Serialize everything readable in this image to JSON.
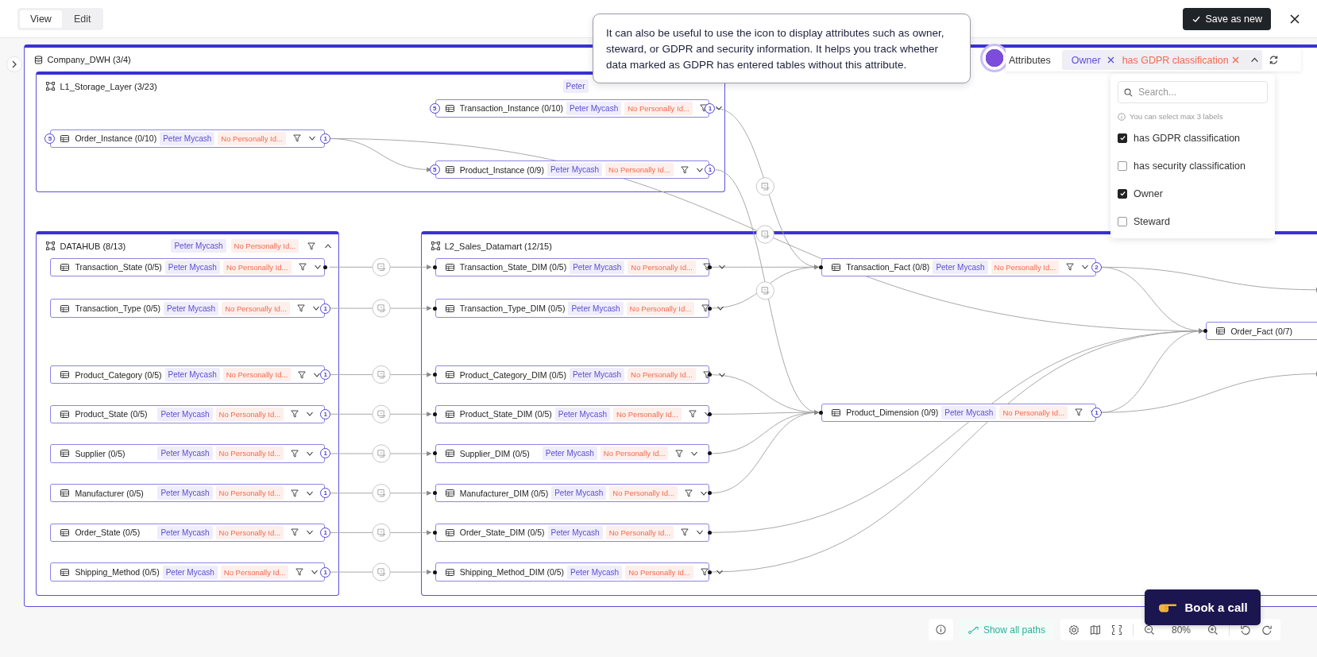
{
  "toolbar": {
    "modes": [
      {
        "label": "View",
        "selected": true
      },
      {
        "label": "Edit",
        "selected": false
      }
    ],
    "save_button": "Save as new"
  },
  "diagram": {
    "title": "Company_DWH (3/4)",
    "groups": [
      {
        "title": "L1_Storage_Layer (3/23)",
        "owner": "Peter",
        "tables": [
          {
            "name": "Transaction_Instance (0/10)",
            "owner": "Peter Mycash",
            "classification": "No Personally Id...",
            "in": {
              "kind": "count",
              "label": "5"
            },
            "out": {
              "kind": "count",
              "label": "1"
            }
          },
          {
            "name": "Order_Instance (0/10)",
            "owner": "Peter Mycash",
            "classification": "No Personally Id...",
            "in": {
              "kind": "count",
              "label": "5"
            },
            "out": {
              "kind": "count",
              "label": "1"
            }
          },
          {
            "name": "Product_Instance (0/9)",
            "owner": "Peter Mycash",
            "classification": "No Personally Id...",
            "in": {
              "kind": "count",
              "label": "5"
            },
            "out": {
              "kind": "count",
              "label": "1"
            }
          }
        ]
      },
      {
        "title": "DATAHUB (8/13)",
        "owner": "Peter Mycash",
        "classification": "No Personally Id...",
        "expanded": true,
        "tables": [
          {
            "name": "Transaction_State (0/5)",
            "owner": "Peter Mycash",
            "classification": "No Personally Id...",
            "out": {
              "kind": "dot"
            }
          },
          {
            "name": "Transaction_Type (0/5)",
            "owner": "Peter Mycash",
            "classification": "No Personally Id...",
            "out": {
              "kind": "count",
              "label": "1"
            }
          },
          {
            "name": "Product_Category (0/5)",
            "owner": "Peter Mycash",
            "classification": "No Personally Id...",
            "out": {
              "kind": "count",
              "label": "1"
            }
          },
          {
            "name": "Product_State (0/5)",
            "owner": "Peter Mycash",
            "classification": "No Personally Id...",
            "out": {
              "kind": "count",
              "label": "1"
            }
          },
          {
            "name": "Supplier (0/5)",
            "owner": "Peter Mycash",
            "classification": "No Personally Id...",
            "out": {
              "kind": "count",
              "label": "1"
            }
          },
          {
            "name": "Manufacturer (0/5)",
            "owner": "Peter Mycash",
            "classification": "No Personally Id...",
            "out": {
              "kind": "count",
              "label": "1"
            }
          },
          {
            "name": "Order_State (0/5)",
            "owner": "Peter Mycash",
            "classification": "No Personally Id...",
            "out": {
              "kind": "count",
              "label": "1"
            }
          },
          {
            "name": "Shipping_Method (0/5)",
            "owner": "Peter Mycash",
            "classification": "No Personally Id...",
            "out": {
              "kind": "count",
              "label": "1"
            }
          }
        ]
      },
      {
        "title": "L2_Sales_Datamart (12/15)",
        "tables": [
          {
            "name": "Transaction_State_DIM (0/5)",
            "owner": "Peter Mycash",
            "classification": "No Personally Id...",
            "in": {
              "kind": "dot"
            },
            "out": {
              "kind": "dot"
            }
          },
          {
            "name": "Transaction_Type_DIM (0/5)",
            "owner": "Peter Mycash",
            "classification": "No Personally Id...",
            "in": {
              "kind": "dot"
            },
            "out": {
              "kind": "dot"
            }
          },
          {
            "name": "Product_Category_DIM (0/5)",
            "owner": "Peter Mycash",
            "classification": "No Personally Id...",
            "in": {
              "kind": "dot"
            },
            "out": {
              "kind": "dot"
            }
          },
          {
            "name": "Product_State_DIM (0/5)",
            "owner": "Peter Mycash",
            "classification": "No Personally Id...",
            "in": {
              "kind": "dot"
            },
            "out": {
              "kind": "dot"
            }
          },
          {
            "name": "Supplier_DIM (0/5)",
            "owner": "Peter Mycash",
            "classification": "No Personally Id...",
            "in": {
              "kind": "dot"
            },
            "out": {
              "kind": "dot"
            }
          },
          {
            "name": "Manufacturer_DIM (0/5)",
            "owner": "Peter Mycash",
            "classification": "No Personally Id...",
            "in": {
              "kind": "dot"
            },
            "out": {
              "kind": "dot"
            }
          },
          {
            "name": "Order_State_DIM (0/5)",
            "owner": "Peter Mycash",
            "classification": "No Personally Id...",
            "in": {
              "kind": "dot"
            },
            "out": {
              "kind": "dot"
            }
          },
          {
            "name": "Shipping_Method_DIM (0/5)",
            "owner": "Peter Mycash",
            "classification": "No Personally Id...",
            "in": {
              "kind": "dot"
            },
            "out": {
              "kind": "dot"
            }
          }
        ]
      }
    ],
    "tables": [
      {
        "name": "Transaction_Fact (0/8)",
        "owner": "Peter Mycash",
        "classification": "No Personally Id...",
        "in": {
          "kind": "dot"
        },
        "out": {
          "kind": "count",
          "label": "2"
        }
      },
      {
        "name": "Product_Dimension (0/9)",
        "owner": "Peter Mycash",
        "classification": "No Personally Id...",
        "in": {
          "kind": "dot"
        },
        "out": {
          "kind": "count",
          "label": "1"
        }
      },
      {
        "name": "Order_Fact (0/7)",
        "in": {
          "kind": "dot"
        }
      }
    ]
  },
  "tooltip": "It can also be useful to use the icon to display attributes such as owner, steward, or GDPR and security information. It helps you track whether data marked as GDPR has entered tables without this attribute.",
  "attributes": {
    "label": "Attributes",
    "expanded": true,
    "chips": [
      {
        "label": "Owner",
        "kind": "owner"
      },
      {
        "label": "has GDPR classification",
        "kind": "classification"
      }
    ],
    "dropdown": {
      "placeholder": "Search...",
      "hint": "You can select max 3 labels",
      "options": [
        {
          "label": "has GDPR classification",
          "checked": true
        },
        {
          "label": "has security classification",
          "checked": false
        },
        {
          "label": "Owner",
          "checked": true
        },
        {
          "label": "Steward",
          "checked": false
        }
      ]
    }
  },
  "controls": {
    "show_paths": "Show all paths",
    "zoom": "80%"
  },
  "book_call": "Book a call"
}
